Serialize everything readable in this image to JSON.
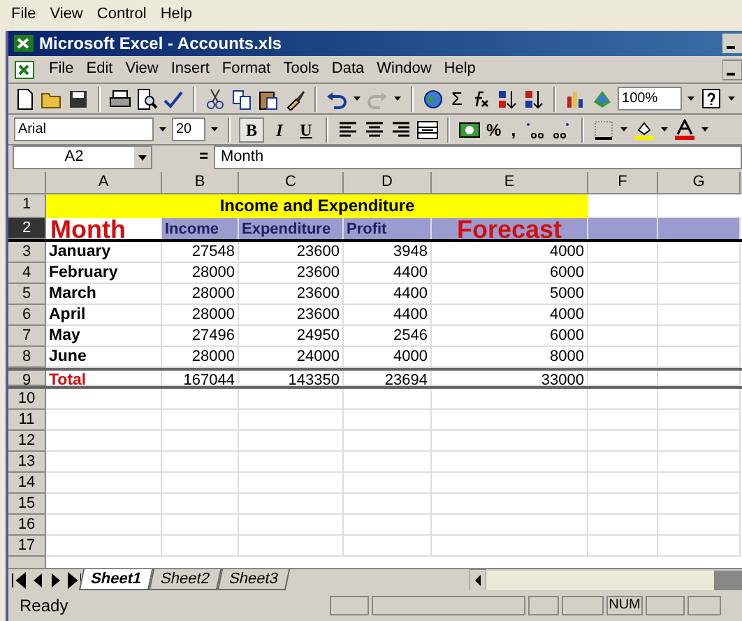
{
  "app_menu": [
    "File",
    "View",
    "Control",
    "Help"
  ],
  "window": {
    "title": "Microsoft Excel - Accounts.xls"
  },
  "menu": [
    "File",
    "Edit",
    "View",
    "Insert",
    "Format",
    "Tools",
    "Data",
    "Window",
    "Help"
  ],
  "standard_toolbar": {
    "autosum": "Σ",
    "zoom": "100%"
  },
  "formatting_toolbar": {
    "font": "Arial",
    "size": "20",
    "bold": "B",
    "italic": "I",
    "underline": "U",
    "percent": "%",
    "comma": ","
  },
  "formula_bar": {
    "name_box": "A2",
    "equals": "=",
    "content": "Month"
  },
  "sheet": {
    "columns": [
      "A",
      "B",
      "C",
      "D",
      "E",
      "F",
      "G"
    ],
    "rows": [
      {
        "header": "1",
        "kind": "title",
        "selected": false,
        "cells": [
          "Income and Expenditure"
        ]
      },
      {
        "header": "2",
        "kind": "heading",
        "selected": true,
        "cells": [
          "Month",
          "Income",
          "Expenditure",
          "Profit",
          "Forecast"
        ]
      },
      {
        "header": "3",
        "kind": "data",
        "selected": false,
        "cells": [
          "January",
          "27548",
          "23600",
          "3948",
          "4000"
        ]
      },
      {
        "header": "4",
        "kind": "data",
        "selected": false,
        "cells": [
          "February",
          "28000",
          "23600",
          "4400",
          "6000"
        ]
      },
      {
        "header": "5",
        "kind": "data",
        "selected": false,
        "cells": [
          "March",
          "28000",
          "23600",
          "4400",
          "5000"
        ]
      },
      {
        "header": "6",
        "kind": "data",
        "selected": false,
        "cells": [
          "April",
          "28000",
          "23600",
          "4400",
          "4000"
        ]
      },
      {
        "header": "7",
        "kind": "data",
        "selected": false,
        "cells": [
          "May",
          "27496",
          "24950",
          "2546",
          "6000"
        ]
      },
      {
        "header": "8",
        "kind": "data",
        "selected": false,
        "cells": [
          "June",
          "28000",
          "24000",
          "4000",
          "8000"
        ]
      },
      {
        "header": "9",
        "kind": "total",
        "selected": false,
        "cells": [
          "Total",
          "167044",
          "143350",
          "23694",
          "33000"
        ]
      },
      {
        "header": "10",
        "kind": "empty",
        "selected": false
      },
      {
        "header": "11",
        "kind": "empty",
        "selected": false
      },
      {
        "header": "12",
        "kind": "empty",
        "selected": false
      },
      {
        "header": "13",
        "kind": "empty",
        "selected": false
      },
      {
        "header": "14",
        "kind": "empty",
        "selected": false
      },
      {
        "header": "15",
        "kind": "empty",
        "selected": false
      },
      {
        "header": "16",
        "kind": "empty",
        "selected": false
      },
      {
        "header": "17",
        "kind": "empty",
        "selected": false
      }
    ]
  },
  "sheet_tabs": [
    {
      "label": "Sheet1",
      "selected": true
    },
    {
      "label": "Sheet2",
      "selected": false
    },
    {
      "label": "Sheet3",
      "selected": false
    }
  ],
  "status_bar": {
    "status": "Ready",
    "indicator": "NUM"
  }
}
